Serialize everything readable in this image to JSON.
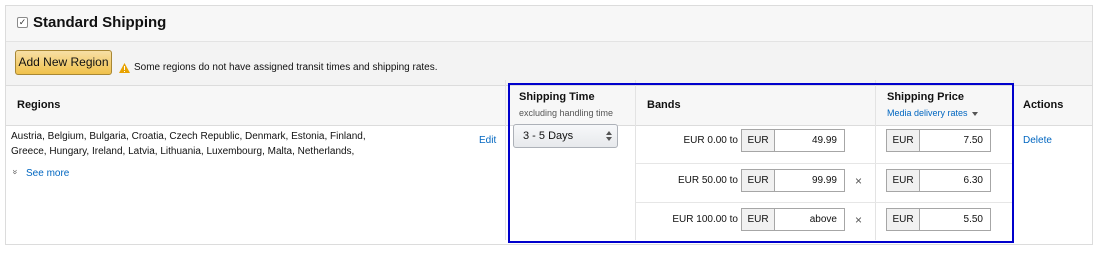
{
  "panel": {
    "title": "Standard Shipping",
    "checkbox_mark": "✓"
  },
  "toolbar": {
    "add_region_label": "Add New Region",
    "warning_text": "Some regions do not have assigned transit times and shipping rates."
  },
  "table": {
    "headers": {
      "regions": "Regions",
      "shipping_time": "Shipping Time",
      "shipping_time_sub": "excluding handling time",
      "bands": "Bands",
      "shipping_price": "Shipping Price",
      "shipping_price_sub": "Media delivery rates",
      "actions": "Actions"
    },
    "region": {
      "countries_line1": "Austria, Belgium, Bulgaria, Croatia, Czech Republic, Denmark, Estonia, Finland,",
      "countries_line2": "Greece, Hungary, Ireland, Latvia, Lithuania, Luxembourg, Malta, Netherlands,",
      "edit_label": "Edit",
      "see_more_label": "See more",
      "see_more_icon": "»"
    },
    "shipping_time_value": "3 - 5 Days",
    "bands": [
      {
        "from": "EUR 0.00 to",
        "currency": "EUR",
        "to": "49.99",
        "price_currency": "EUR",
        "price": "7.50",
        "removable": false
      },
      {
        "from": "EUR 50.00 to",
        "currency": "EUR",
        "to": "99.99",
        "price_currency": "EUR",
        "price": "6.30",
        "removable": true
      },
      {
        "from": "EUR 100.00 to",
        "currency": "EUR",
        "to": "above",
        "price_currency": "EUR",
        "price": "5.50",
        "removable": true
      }
    ],
    "remove_glyph": "×",
    "delete_label": "Delete"
  },
  "colors": {
    "link": "#0066c0",
    "highlight": "#0000cc",
    "button_top": "#f7dfa5",
    "button_bottom": "#f0c14b",
    "warning": "#e8a200"
  }
}
